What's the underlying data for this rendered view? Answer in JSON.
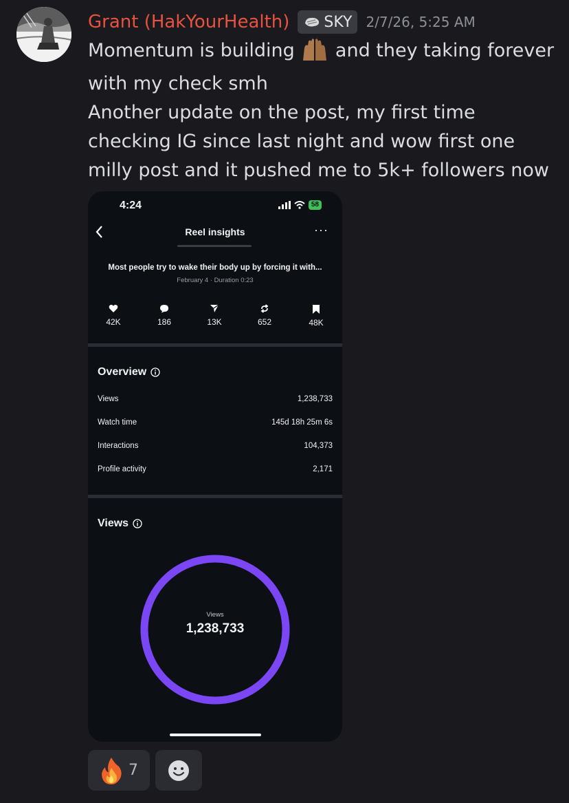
{
  "message": {
    "username": "Grant (HakYourHealth)",
    "tag": "SKY",
    "timestamp": "2/7/26, 5:25 AM",
    "line1_before": "Momentum is building",
    "line1_after": " and they taking forever with my check smh",
    "line2": "Another update on the post, my first time checking IG since last night and wow first one milly post and it pushed me to 5k+ followers now"
  },
  "screenshot": {
    "status_time": "4:24",
    "battery": "58",
    "title": "Reel insights",
    "more": "···",
    "caption": "Most people try to wake their body up by forcing it with...",
    "meta": "February 4 · Duration 0:23",
    "stats": {
      "likes": "42K",
      "comments": "186",
      "shares": "13K",
      "reposts": "652",
      "saves": "48K"
    },
    "overview": {
      "title": "Overview",
      "rows": [
        {
          "label": "Views",
          "value": "1,238,733"
        },
        {
          "label": "Watch time",
          "value": "145d 18h 25m 6s"
        },
        {
          "label": "Interactions",
          "value": "104,373"
        },
        {
          "label": "Profile activity",
          "value": "2,171"
        }
      ]
    },
    "views_section": {
      "title": "Views",
      "ring_label": "Views",
      "ring_value": "1,238,733",
      "ring_color": "#7b47f5"
    }
  },
  "reactions": {
    "fire_count": "7"
  },
  "colors": {
    "username": "#e8523f",
    "background": "#1a1a1e",
    "accent_ring": "#7b47f5"
  },
  "icons": [
    "avatar",
    "sky-badge-icon",
    "raised-hands-emoji",
    "back-icon",
    "heart-icon",
    "comment-icon",
    "share-icon",
    "repost-icon",
    "bookmark-icon",
    "info-icon",
    "fire-emoji",
    "add-reaction-icon"
  ]
}
